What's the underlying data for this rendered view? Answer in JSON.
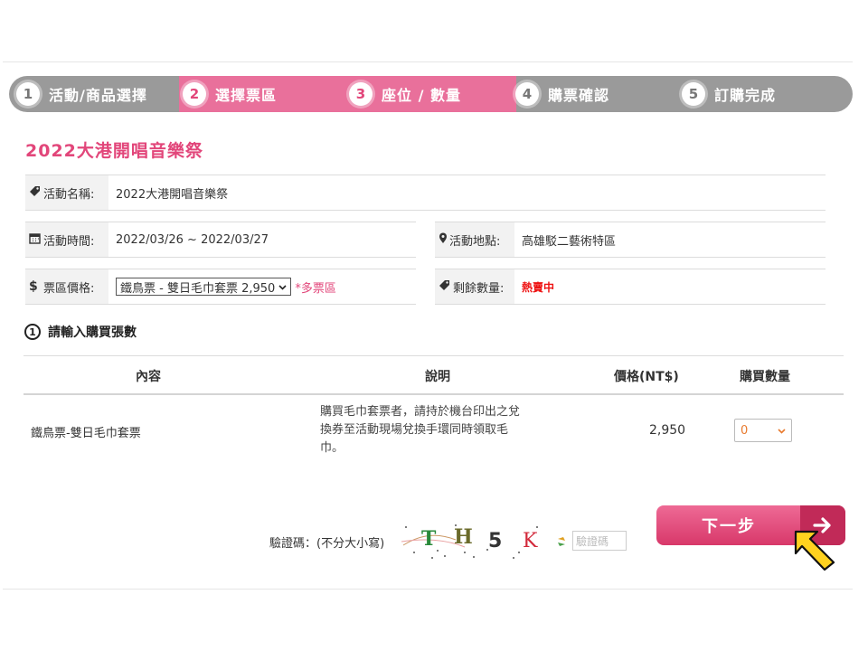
{
  "steps": [
    {
      "num": "1",
      "label": "活動/商品選擇"
    },
    {
      "num": "2",
      "label": "選擇票區"
    },
    {
      "num": "3",
      "label": "座位 / 數量"
    },
    {
      "num": "4",
      "label": "購票確認"
    },
    {
      "num": "5",
      "label": "訂購完成"
    }
  ],
  "event": {
    "title": "2022大港開唱音樂祭",
    "name_label": "活動名稱:",
    "name": "2022大港開唱音樂祭",
    "time_label": "活動時間:",
    "time": "2022/03/26 ~ 2022/03/27",
    "place_label": "活動地點:",
    "place": "高雄駁二藝術特區",
    "price_label": "票區價格:",
    "price_selected": "鐵鳥票 - 雙日毛巾套票 2,950",
    "multi_zone": "*多票區",
    "remain_label": "剩餘數量:",
    "remain": "熱賣中"
  },
  "section": {
    "num": "1",
    "title": "請輸入購買張數"
  },
  "table": {
    "headers": [
      "內容",
      "說明",
      "價格(NT$)",
      "購買數量"
    ],
    "rows": [
      {
        "content": "鐵鳥票-雙日毛巾套票",
        "desc_lines": [
          "購買毛巾套票者，請持於機台印出之兌",
          "換券至活動現場兌換手環同時領取毛",
          "巾。"
        ],
        "price": "2,950",
        "qty": "0"
      }
    ]
  },
  "captcha": {
    "label": "驗證碼：(不分大小寫)",
    "chars": [
      "T",
      "H",
      "5",
      "K"
    ],
    "placeholder": "驗證碼"
  },
  "next_button": "下一步",
  "icons": {
    "name": "ticket-icon",
    "time": "calendar-icon",
    "place": "map-pin-icon",
    "price": "dollar-icon",
    "remain": "ticket-icon",
    "cursor": "arrow-cursor-icon"
  },
  "colors": {
    "accent": "#e2467a",
    "step_active": "#e9709b",
    "step_inactive": "#9a9a9a",
    "cursor": "#ffd21f"
  }
}
